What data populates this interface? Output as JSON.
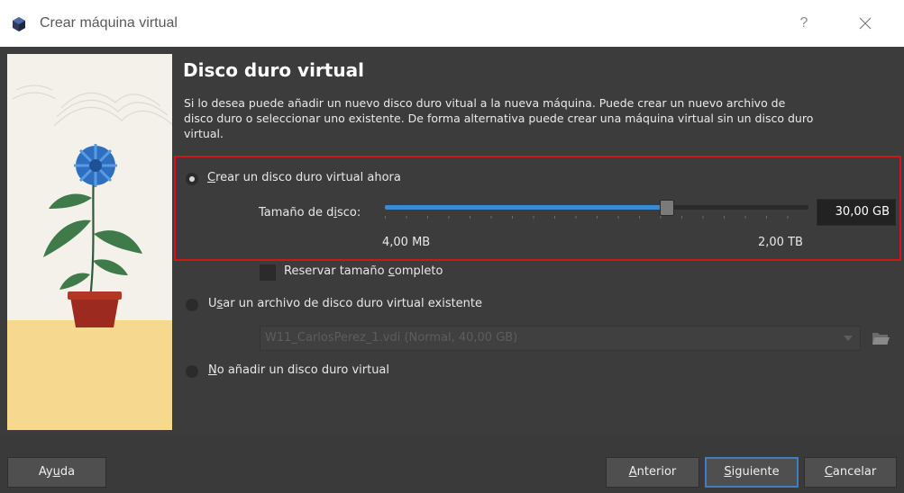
{
  "window": {
    "title": "Crear máquina virtual",
    "help_glyph": "?",
    "close_glyph": "×"
  },
  "page": {
    "title": "Disco duro virtual",
    "description": "Si lo desea puede añadir un nuevo disco duro vitual a la nueva máquina. Puede crear un nuevo archivo de disco duro o seleccionar uno existente. De forma alternativa puede crear una máquina virtual sin un disco duro virtual."
  },
  "options": {
    "create_now": {
      "label_pre": "",
      "label_mnemonic": "C",
      "label_post": "rear un disco duro virtual ahora",
      "checked": true
    },
    "use_existing": {
      "label_pre": "U",
      "label_mnemonic": "s",
      "label_post": "ar un archivo de disco duro virtual existente",
      "checked": false
    },
    "no_disk": {
      "label_pre": "",
      "label_mnemonic": "N",
      "label_post": "o añadir un disco duro virtual",
      "checked": false
    }
  },
  "disk_size": {
    "label_pre": "Tamaño de d",
    "label_mnemonic": "i",
    "label_post": "sco:",
    "value": "30,00 GB",
    "min_label": "4,00 MB",
    "max_label": "2,00 TB",
    "slider_fraction": 0.665
  },
  "reserve_full": {
    "label_pre": "Reservar tamaño ",
    "label_mnemonic": "c",
    "label_post": "ompleto",
    "checked": false
  },
  "existing_disk": {
    "selected": "W11_CarlosPerez_1.vdi (Normal, 40,00 GB)",
    "enabled": false
  },
  "buttons": {
    "help": {
      "pre": "Ay",
      "mnemonic": "u",
      "post": "da"
    },
    "back": {
      "pre": "",
      "mnemonic": "A",
      "post": "nterior"
    },
    "next": {
      "pre": "",
      "mnemonic": "S",
      "post": "iguiente"
    },
    "cancel": {
      "pre": "",
      "mnemonic": "C",
      "post": "ancelar"
    }
  },
  "colors": {
    "accent": "#3c8ad2",
    "highlight_border": "#d4141c",
    "dialog_bg": "#3c3c3c"
  }
}
